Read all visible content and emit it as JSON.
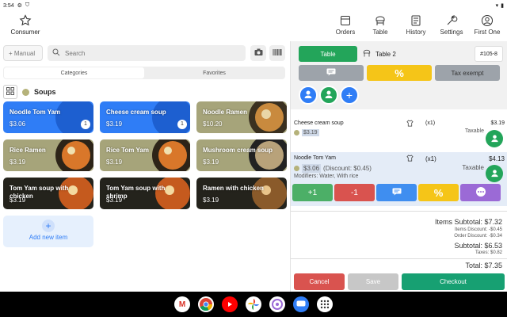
{
  "statusbar": {
    "time": "3:54"
  },
  "nav": {
    "consumer": "Consumer",
    "orders": "Orders",
    "table": "Table",
    "history": "History",
    "settings": "Settings",
    "first_one": "First One"
  },
  "toolbar": {
    "manual_label": "+ Manual",
    "search_placeholder": "Search"
  },
  "tabs": [
    "Categories",
    "Favorites"
  ],
  "category": {
    "name": "Soups"
  },
  "products": [
    {
      "name": "Noodle Tom Yam",
      "price": "$3.06",
      "count": "1"
    },
    {
      "name": "Cheese cream soup",
      "price": "$3.19",
      "count": "1"
    },
    {
      "name": "Noodle Ramen",
      "price": "$10.20"
    },
    {
      "name": "Rice Ramen",
      "price": "$3.19"
    },
    {
      "name": "Rice Tom Yam",
      "price": "$3.19"
    },
    {
      "name": "Mushroom cream soup",
      "price": "$3.19"
    },
    {
      "name": "Tom Yam soup with chicken",
      "price": "$3.19"
    },
    {
      "name": "Tom Yam soup with shrimp",
      "price": "$3.19"
    },
    {
      "name": "Ramen with chicken",
      "price": "$3.19"
    }
  ],
  "add_item": "Add new item",
  "order": {
    "table_button": "Table",
    "table_name": "Table 2",
    "order_number": "#105-8",
    "discount_symbol": "%",
    "tax_exempt": "Tax exempt",
    "items": [
      {
        "name": "Cheese cream soup",
        "qty": "(x1)",
        "price": "$3.19",
        "unit": "$3.19",
        "taxable": "Taxable"
      },
      {
        "name": "Noodle Tom Yam",
        "qty": "(x1)",
        "price": "$4.13",
        "unit": "$3.06",
        "discount": "(Discount: $0.45)",
        "taxable": "Taxable",
        "modifiers": "Modifiers: Water, With rice"
      }
    ],
    "mods": {
      "plus": "+1",
      "minus": "-1",
      "percent": "%"
    },
    "totals": {
      "items_subtotal": "Items Subtotal: $7.32",
      "items_discount": "Items Discount: -$0.45",
      "order_discount": "Order Discount: -$0.34",
      "subtotal": "Subtotal: $6.53",
      "taxes": "Taxes: $0.82",
      "total": "Total: $7.35"
    },
    "buttons": {
      "cancel": "Cancel",
      "save": "Save",
      "checkout": "Checkout"
    }
  },
  "colors": {
    "green": "#23a55a",
    "blue": "#2f7df6",
    "yellow": "#f5c518",
    "red": "#d9534f",
    "purple": "#9b6ad6"
  }
}
